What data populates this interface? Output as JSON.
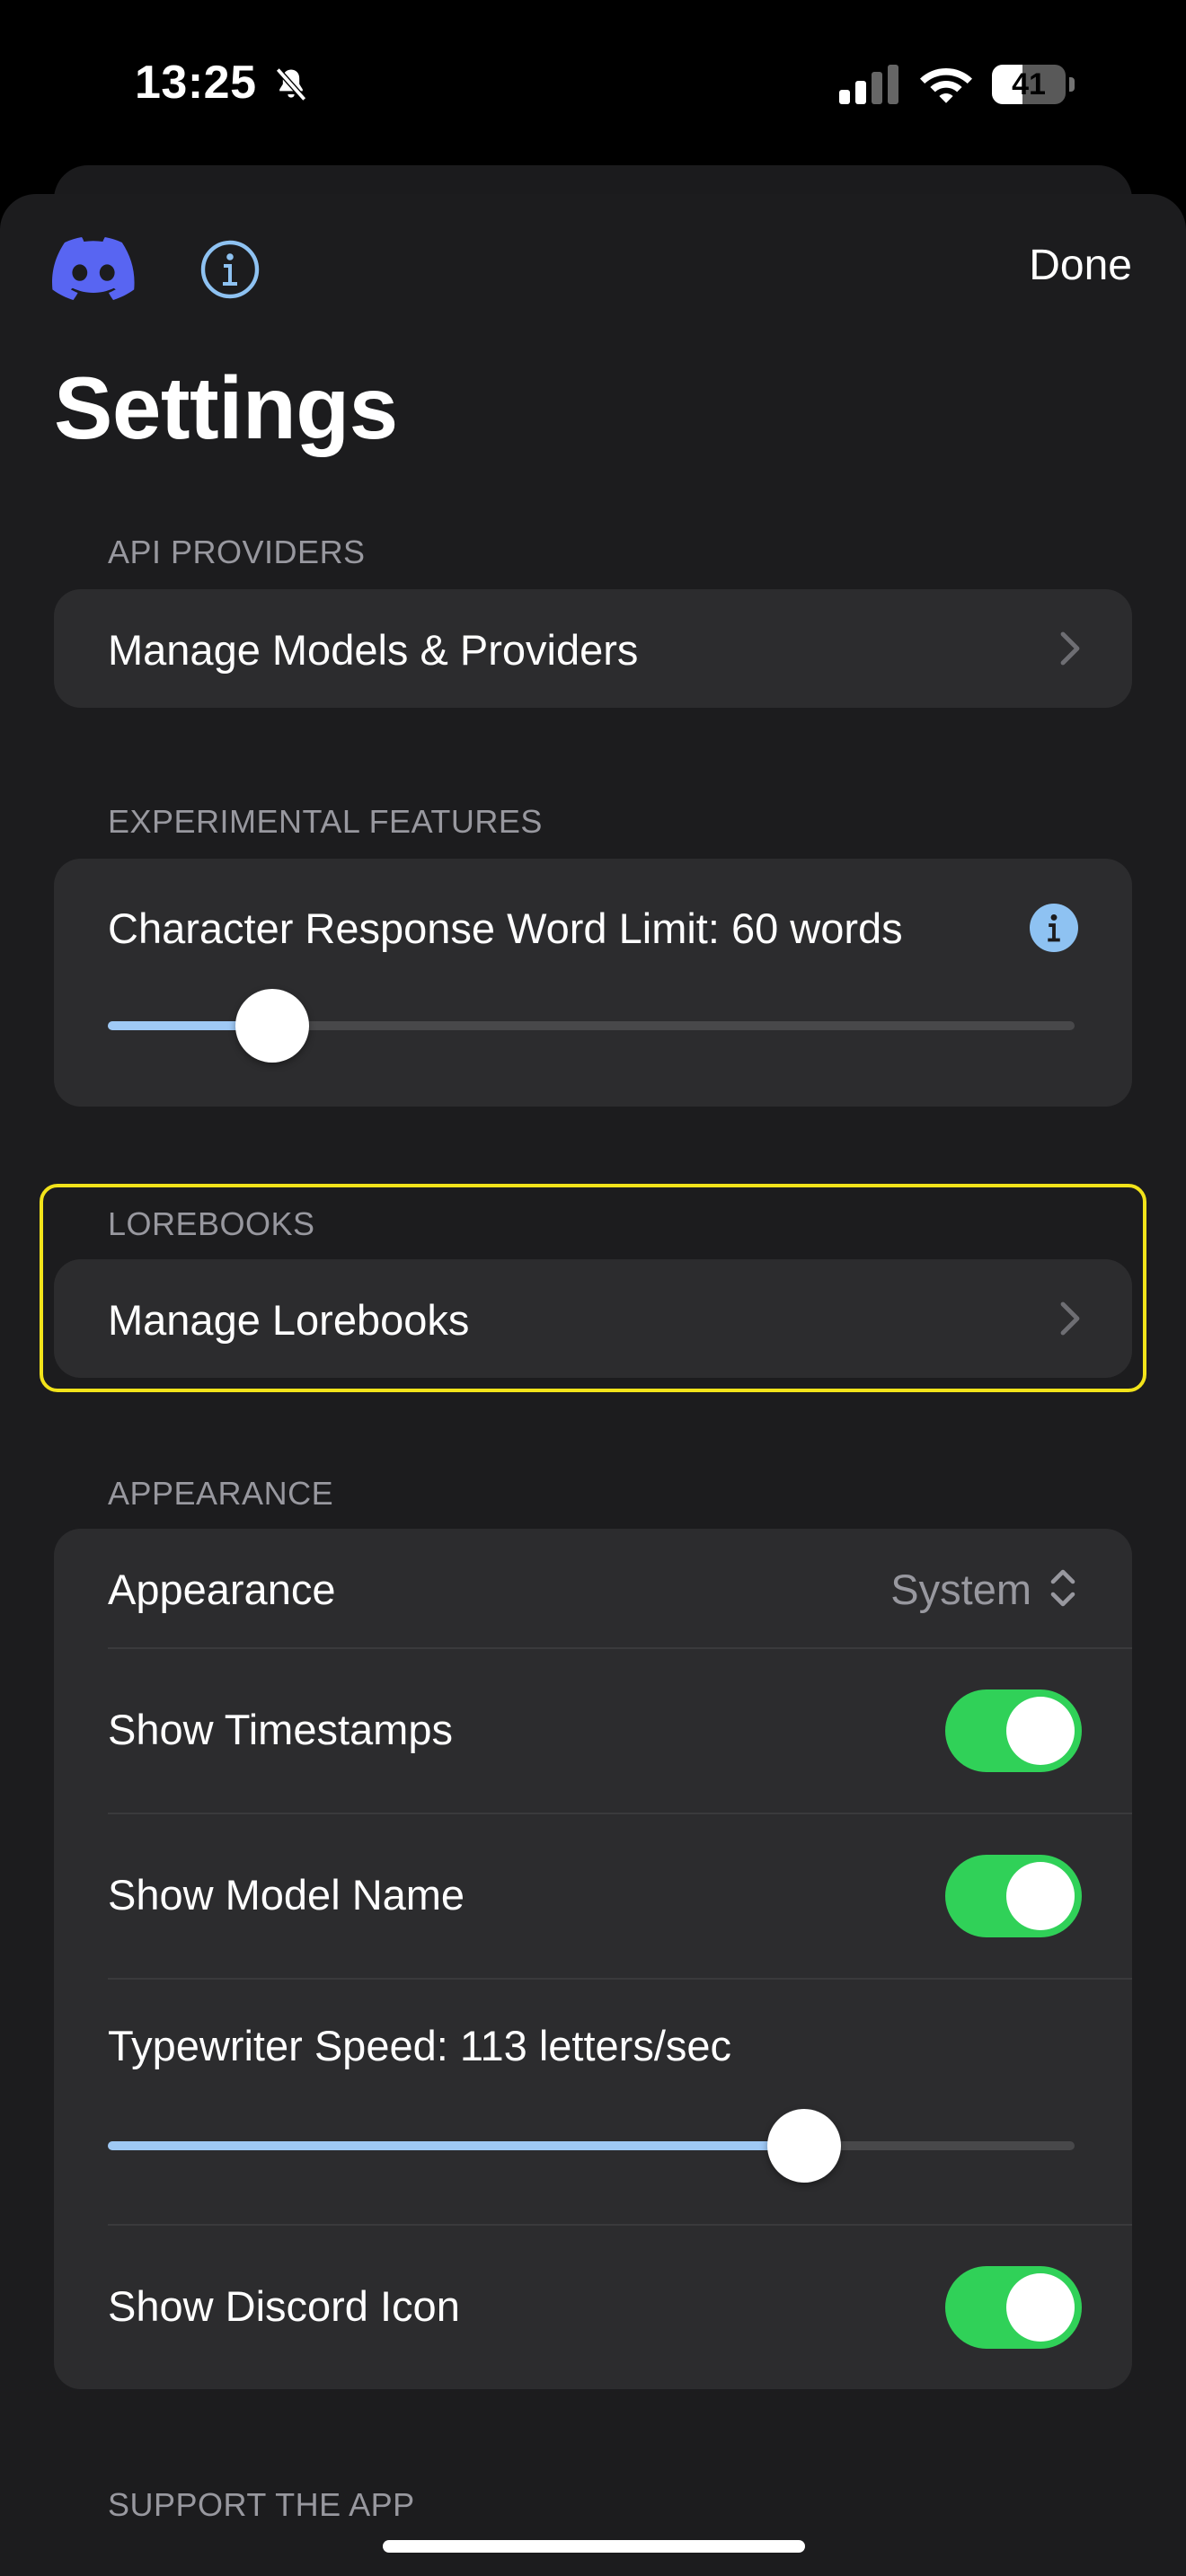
{
  "status_bar": {
    "time": "13:25",
    "battery": "41",
    "battery_level": 0.41
  },
  "nav": {
    "done_label": "Done",
    "title": "Settings"
  },
  "sections": {
    "api": {
      "header": "API PROVIDERS",
      "manage_models_label": "Manage Models & Providers"
    },
    "experimental": {
      "header": "EXPERIMENTAL FEATURES",
      "word_limit_label": "Character Response Word Limit: 60 words",
      "word_limit_slider_value": 0.17
    },
    "lorebooks": {
      "header": "LOREBOOKS",
      "manage_lorebooks_label": "Manage Lorebooks"
    },
    "appearance": {
      "header": "APPEARANCE",
      "appearance_label": "Appearance",
      "appearance_value": "System",
      "show_timestamps_label": "Show Timestamps",
      "show_timestamps_on": true,
      "show_model_name_label": "Show Model Name",
      "show_model_name_on": true,
      "typewriter_label": "Typewriter Speed: 113 letters/sec",
      "typewriter_slider_value": 0.72,
      "show_discord_label": "Show Discord Icon",
      "show_discord_on": true
    },
    "support": {
      "header": "SUPPORT THE APP"
    }
  },
  "colors": {
    "toggle_on": "#30d158",
    "slider_fill": "#9fc9f5",
    "highlight": "#f2e31a",
    "discord": "#5865f2",
    "info_blue": "#8ec2f2"
  }
}
